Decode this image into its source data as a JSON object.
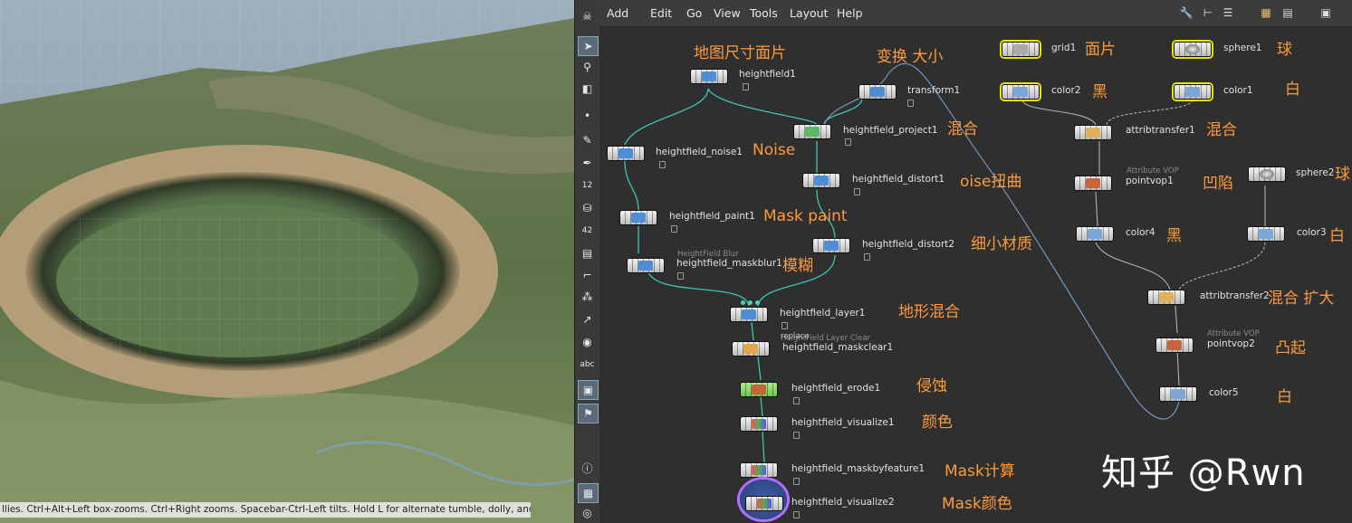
{
  "menubar": {
    "items": [
      "Add",
      "Edit",
      "Go",
      "View",
      "Tools",
      "Layout",
      "Help"
    ],
    "tool_icons": [
      "wrench-icon",
      "tree-icon",
      "list-icon",
      "grid-icon",
      "table-icon",
      "image-icon"
    ]
  },
  "shelf": {
    "tools": [
      "skull-icon",
      "select-icon",
      "view-icon",
      "camera-icon",
      "dot-icon",
      "brush-icon",
      "pen-icon",
      "number-12-icon",
      "bucket-icon",
      "number-42-icon",
      "stack-icon",
      "ruler-icon",
      "snap-icon",
      "hook-icon",
      "circle-icon",
      "abc-label",
      "picture-icon",
      "pin-icon",
      "info-icon",
      "layout-icon",
      "eye-icon"
    ],
    "labels": {
      "n12": "12",
      "n42": "42",
      "abc": "abc",
      "info": "i"
    }
  },
  "viewport": {
    "status_text": "llies. Ctrl+Alt+Left box-zooms. Ctrl+Right zooms. Spacebar-Ctrl-Left tilts. Hold L for alternate tumble, dolly, and zoom."
  },
  "nodes": [
    {
      "id": "heightfield1",
      "label": "heightfield1"
    },
    {
      "id": "transform1",
      "label": "transform1"
    },
    {
      "id": "heightfield_project1",
      "label": "heightfield_project1"
    },
    {
      "id": "heightfield_noise1",
      "label": "heightfield_noise1"
    },
    {
      "id": "heightfield_distort1",
      "label": "heightfield_distort1"
    },
    {
      "id": "heightfield_paint1",
      "label": "heightfield_paint1"
    },
    {
      "id": "heightfield_distort2",
      "label": "heightfield_distort2"
    },
    {
      "id": "heightfield_maskblur1",
      "label": "heightfield_maskblur1",
      "sublabel": "HeightField Blur"
    },
    {
      "id": "heightfield_layer1",
      "label": "heightfield_layer1"
    },
    {
      "id": "heightfield_maskclear1",
      "label": "heightfield_maskclear1",
      "sublabel": "HeightField Layer Clear",
      "tag": "replace"
    },
    {
      "id": "heightfield_erode1",
      "label": "heightfield_erode1"
    },
    {
      "id": "heightfield_visualize1",
      "label": "heightfield_visualize1"
    },
    {
      "id": "heightfield_maskbyfeature1",
      "label": "heightfield_maskbyfeature1"
    },
    {
      "id": "heightfield_visualize2",
      "label": "heightfield_visualize2"
    },
    {
      "id": "grid1",
      "label": "grid1"
    },
    {
      "id": "color2",
      "label": "color2"
    },
    {
      "id": "sphere1",
      "label": "sphere1"
    },
    {
      "id": "color1",
      "label": "color1"
    },
    {
      "id": "attribtransfer1",
      "label": "attribtransfer1"
    },
    {
      "id": "pointvop1",
      "label": "pointvop1",
      "sublabel": "Attribute VOP"
    },
    {
      "id": "sphere2",
      "label": "sphere2"
    },
    {
      "id": "color4",
      "label": "color4"
    },
    {
      "id": "color3",
      "label": "color3"
    },
    {
      "id": "attribtransfer2",
      "label": "attribtransfer2"
    },
    {
      "id": "pointvop2",
      "label": "pointvop2",
      "sublabel": "Attribute VOP"
    },
    {
      "id": "color5",
      "label": "color5"
    }
  ],
  "annotations": [
    "地图尺寸面片",
    "变换 大小",
    "混合",
    "Noise",
    "oise扭曲",
    "Mask paint",
    "细小材质",
    "模糊",
    "地形混合",
    "侵蚀",
    "颜色",
    "Mask计算",
    "Mask颜色",
    "面片",
    "黑",
    "球",
    "白",
    "混合",
    "凹陷",
    "球",
    "黑",
    "白",
    "混合 扩大",
    "凸起",
    "白"
  ],
  "watermark": "知乎 @Rwn",
  "colors": {
    "wire": "#3cc6b4",
    "wire_blue": "#7f9fc8",
    "annotation": "#ff9a3c",
    "selected": "#e6e600"
  }
}
